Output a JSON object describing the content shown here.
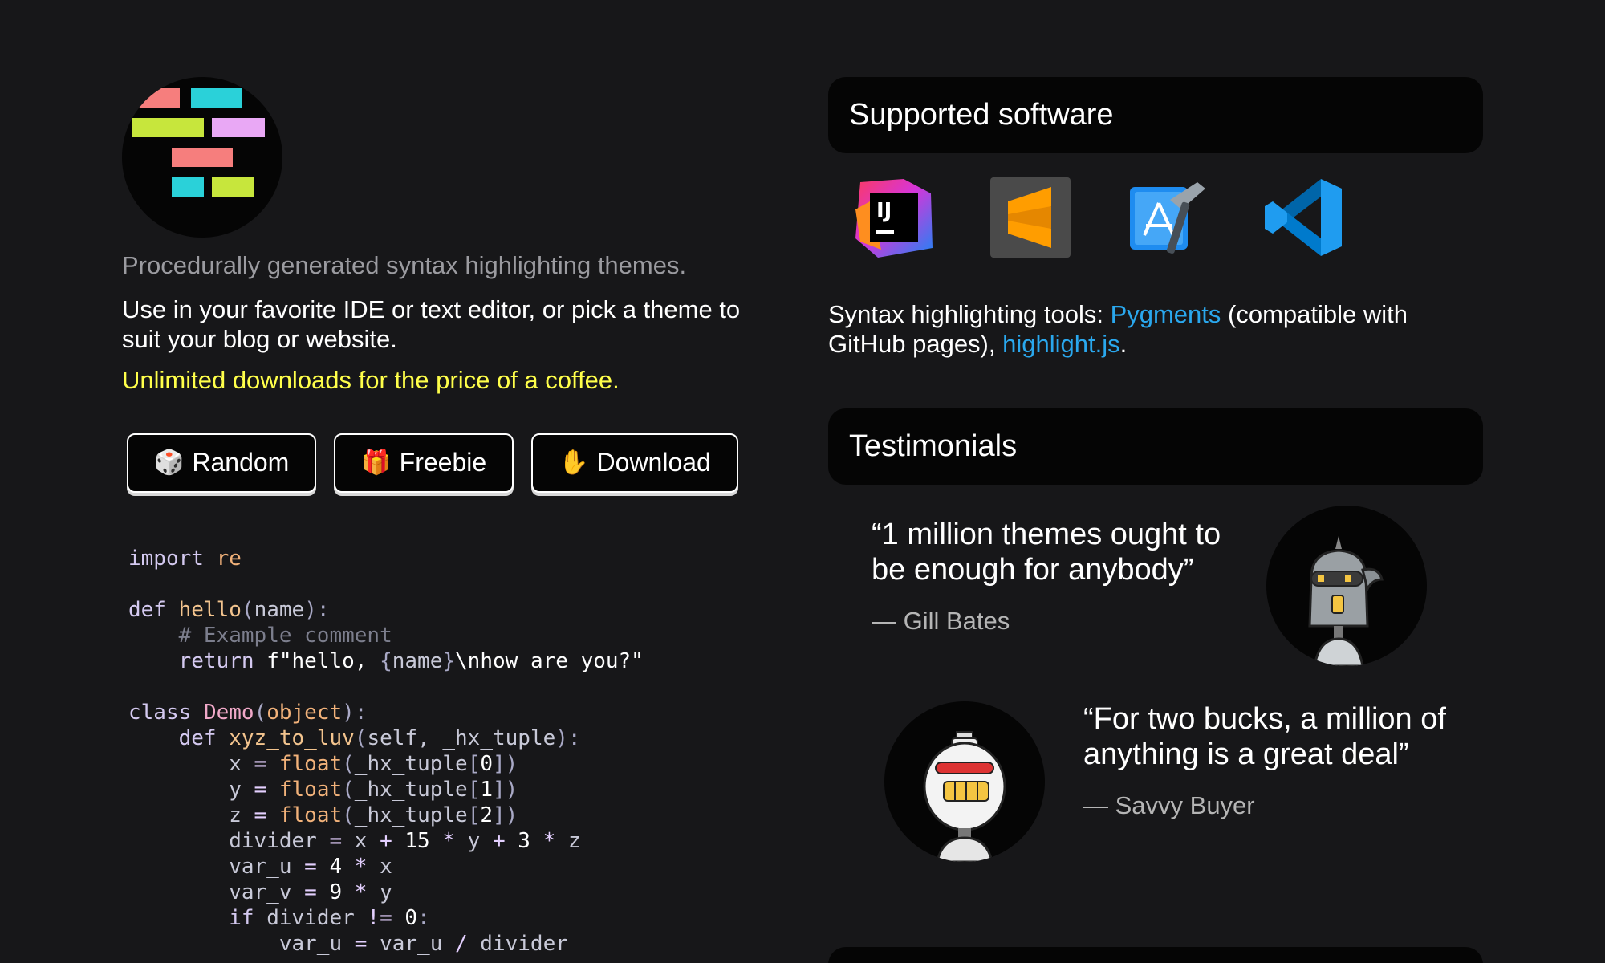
{
  "hero": {
    "logo_icon": "theme-logo-icon",
    "tagline": "Procedurally generated syntax highlighting themes.",
    "description": "Use in your favorite IDE or text editor, or pick a theme to suit your blog or website.",
    "promo": "Unlimited downloads for the price of a coffee."
  },
  "buttons": {
    "random": {
      "emoji": "🎲",
      "label": "Random"
    },
    "freebie": {
      "emoji": "🎁",
      "label": "Freebie"
    },
    "download": {
      "emoji": "✋",
      "label": "Download"
    }
  },
  "code_lines": [
    [
      [
        "kw",
        "import"
      ],
      [
        "id",
        " "
      ],
      [
        "mod",
        "re"
      ]
    ],
    [],
    [
      [
        "kw",
        "def"
      ],
      [
        "id",
        " "
      ],
      [
        "fn",
        "hello"
      ],
      [
        "pun",
        "("
      ],
      [
        "id",
        "name"
      ],
      [
        "pun",
        "):"
      ]
    ],
    [
      [
        "id",
        "    "
      ],
      [
        "cmt",
        "# Example comment"
      ]
    ],
    [
      [
        "id",
        "    "
      ],
      [
        "kw",
        "return"
      ],
      [
        "id",
        " "
      ],
      [
        "str",
        "f\"hello, "
      ],
      [
        "pun",
        "{"
      ],
      [
        "id",
        "name"
      ],
      [
        "pun",
        "}"
      ],
      [
        "str",
        "\\nhow are you?\""
      ]
    ],
    [],
    [
      [
        "kw",
        "class"
      ],
      [
        "id",
        " "
      ],
      [
        "cls",
        "Demo"
      ],
      [
        "pun",
        "("
      ],
      [
        "bi",
        "object"
      ],
      [
        "pun",
        "):"
      ]
    ],
    [
      [
        "id",
        "    "
      ],
      [
        "kw",
        "def"
      ],
      [
        "id",
        " "
      ],
      [
        "fn",
        "xyz_to_luv"
      ],
      [
        "pun",
        "("
      ],
      [
        "id",
        "self, _hx_tuple"
      ],
      [
        "pun",
        "):"
      ]
    ],
    [
      [
        "id",
        "        x "
      ],
      [
        "op",
        "="
      ],
      [
        "id",
        " "
      ],
      [
        "bi",
        "float"
      ],
      [
        "pun",
        "("
      ],
      [
        "id",
        "_hx_tuple"
      ],
      [
        "pun",
        "["
      ],
      [
        "num",
        "0"
      ],
      [
        "pun",
        "])"
      ]
    ],
    [
      [
        "id",
        "        y "
      ],
      [
        "op",
        "="
      ],
      [
        "id",
        " "
      ],
      [
        "bi",
        "float"
      ],
      [
        "pun",
        "("
      ],
      [
        "id",
        "_hx_tuple"
      ],
      [
        "pun",
        "["
      ],
      [
        "num",
        "1"
      ],
      [
        "pun",
        "])"
      ]
    ],
    [
      [
        "id",
        "        z "
      ],
      [
        "op",
        "="
      ],
      [
        "id",
        " "
      ],
      [
        "bi",
        "float"
      ],
      [
        "pun",
        "("
      ],
      [
        "id",
        "_hx_tuple"
      ],
      [
        "pun",
        "["
      ],
      [
        "num",
        "2"
      ],
      [
        "pun",
        "])"
      ]
    ],
    [
      [
        "id",
        "        divider "
      ],
      [
        "op",
        "="
      ],
      [
        "id",
        " x "
      ],
      [
        "op",
        "+"
      ],
      [
        "id",
        " "
      ],
      [
        "num",
        "15"
      ],
      [
        "id",
        " "
      ],
      [
        "op",
        "*"
      ],
      [
        "id",
        " y "
      ],
      [
        "op",
        "+"
      ],
      [
        "id",
        " "
      ],
      [
        "num",
        "3"
      ],
      [
        "id",
        " "
      ],
      [
        "op",
        "*"
      ],
      [
        "id",
        " z"
      ]
    ],
    [
      [
        "id",
        "        var_u "
      ],
      [
        "op",
        "="
      ],
      [
        "id",
        " "
      ],
      [
        "num",
        "4"
      ],
      [
        "id",
        " "
      ],
      [
        "op",
        "*"
      ],
      [
        "id",
        " x"
      ]
    ],
    [
      [
        "id",
        "        var_v "
      ],
      [
        "op",
        "="
      ],
      [
        "id",
        " "
      ],
      [
        "num",
        "9"
      ],
      [
        "id",
        " "
      ],
      [
        "op",
        "*"
      ],
      [
        "id",
        " y"
      ]
    ],
    [
      [
        "id",
        "        "
      ],
      [
        "kw",
        "if"
      ],
      [
        "id",
        " divider "
      ],
      [
        "op",
        "!="
      ],
      [
        "id",
        " "
      ],
      [
        "num",
        "0"
      ],
      [
        "pun",
        ":"
      ]
    ],
    [
      [
        "id",
        "            var_u "
      ],
      [
        "op",
        "="
      ],
      [
        "id",
        " var_u "
      ],
      [
        "op",
        "/"
      ],
      [
        "id",
        " divider"
      ]
    ]
  ],
  "supported": {
    "title": "Supported software",
    "icons": [
      "intellij-idea-icon",
      "sublime-text-icon",
      "xcode-icon",
      "vscode-icon"
    ],
    "tools_prefix": "Syntax highlighting tools: ",
    "pygments": "Pygments",
    "tools_middle": " (compatible with GitHub pages), ",
    "highlightjs": "highlight.js",
    "tools_suffix": "."
  },
  "testimonials": {
    "title": "Testimonials",
    "items": [
      {
        "quote": "“1 million themes ought to be enough for anybody”",
        "author": "— Gill Bates",
        "avatar": "robot-avatar-icon"
      },
      {
        "quote": "“For two bucks, a million of anything is a great deal”",
        "author": "— Savvy Buyer",
        "avatar": "robot-avatar-icon"
      }
    ]
  },
  "colors": {
    "background": "#171719",
    "panel": "#050505",
    "promo": "#ffff4a",
    "link": "#2aa8ee"
  }
}
